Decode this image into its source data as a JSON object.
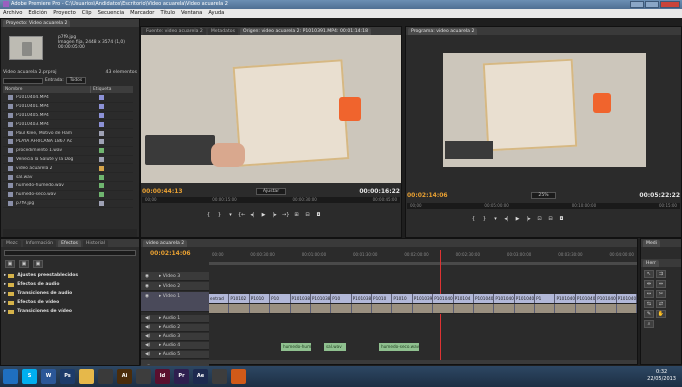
{
  "window": {
    "title": "Adobe Premiere Pro - C:\\Usuarios\\Andidatos\\Escritorio\\Video acuarela\\Video acuarela 2"
  },
  "menu": [
    "Archivo",
    "Edición",
    "Proyecto",
    "Clip",
    "Secuencia",
    "Marcador",
    "Título",
    "Ventana",
    "Ayuda"
  ],
  "project": {
    "tab_label": "Proyecto: Video acuarela 2",
    "preview": {
      "name": "p7f9.jpg",
      "type": "Imagen fija, 2448 x 3574 (1,0)",
      "duration": "00:00:05:00"
    },
    "project_name": "Video acuarela 2.prproj",
    "item_count": "43 elementos",
    "entry_label": "Entrada:",
    "entry_value": "Todos",
    "col_name": "Nombre",
    "col_label": "Etiqueta",
    "files": [
      {
        "name": "P1010404.MP4",
        "chip": "#8c91d6"
      },
      {
        "name": "P1010401.MP4",
        "chip": "#8c91d6"
      },
      {
        "name": "P1010405.MP4",
        "chip": "#8c91d6"
      },
      {
        "name": "P1010403.MP4",
        "chip": "#8c91d6"
      },
      {
        "name": "Paul Klee, Motivo de Ham",
        "chip": "#9fa2b5"
      },
      {
        "name": "PLAYA AFRICANA 1867 Ac",
        "chip": "#9fa2b5"
      },
      {
        "name": "procedimiento 1.wav",
        "chip": "#6fb56f"
      },
      {
        "name": "Venecia la Salute y la Dog",
        "chip": "#9fa2b5"
      },
      {
        "name": "video acuarela 2",
        "chip": "#d6a44a"
      },
      {
        "name": "sal.wav",
        "chip": "#6fb56f"
      },
      {
        "name": "humedo-humedo.wav",
        "chip": "#6fb56f"
      },
      {
        "name": "humedo-seco.wav",
        "chip": "#6fb56f"
      },
      {
        "name": "p7f9.jpg",
        "chip": "#9fa2b5"
      }
    ]
  },
  "source_monitor": {
    "tabs": [
      "Fuente: video acuarela 2",
      "Metadatos",
      "Origen: video acuarela 2: P1010391.MP4: 00:01:14:18"
    ],
    "timecode_in": "00:00:44:13",
    "fit": "Ajustar",
    "timecode_dur": "00:00:16:22",
    "ruler": [
      "00;00",
      "00:00:15:00",
      "00:00:30:00",
      "00:00:45:00"
    ]
  },
  "program_monitor": {
    "tab": "Programa: video acuarela 2",
    "timecode_in": "00:02:14:06",
    "zoom": "25%",
    "timecode_dur": "00:05:22:22",
    "ruler": [
      "00;00",
      "00:05:00:00",
      "00:10:00:00",
      "00:15:00"
    ]
  },
  "timeline": {
    "tab": "video acuarela 2",
    "timecode": "00:02:14:06",
    "ruler": [
      "00:00",
      "00:00:30:00",
      "00:01:00:00",
      "00:01:30:00",
      "00:02:00:00",
      "00:02:30:00",
      "00:03:00:00",
      "00:03:30:00",
      "00:04:00:00"
    ],
    "video_tracks": [
      "Vídeo 3",
      "Vídeo 2",
      "Vídeo 1"
    ],
    "audio_tracks": [
      "Audio 1",
      "Audio 2",
      "Audio 3",
      "Audio 4",
      "Audio 5",
      "Audio 6",
      "Audio 7"
    ],
    "video_clips": [
      "entrad",
      "P10102",
      "P1010",
      "P10",
      "P1010384",
      "P1010385",
      "P10",
      "P1010389",
      "P1010",
      "P1010",
      "P1010391",
      "P1010401",
      "P10104",
      "P1010401",
      "P1010401",
      "P1010401",
      "P1",
      "P1010402",
      "P1010402",
      "P1010403",
      "P1010403"
    ],
    "audio_clips": [
      "humedo-hum",
      "sal.wav",
      "humedo-seco.wav"
    ]
  },
  "tools_tab": "Herr",
  "media_tab": "Medi",
  "left_bottom_tabs": [
    "Mezc",
    "Información",
    "Efectos",
    "Historial"
  ],
  "effects": {
    "folders": [
      "Ajustes preestablecidos",
      "Efectos de audio",
      "Transiciones de audio",
      "Efectos de vídeo",
      "Transiciones de vídeo"
    ]
  },
  "taskbar": {
    "apps": [
      {
        "name": "windows-start-icon",
        "label": "",
        "color": "#1f6fc0"
      },
      {
        "name": "skype-icon",
        "label": "S",
        "color": "#00aff0"
      },
      {
        "name": "word-icon",
        "label": "W",
        "color": "#2b5797"
      },
      {
        "name": "photoshop-icon",
        "label": "Ps",
        "color": "#1c3b6a"
      },
      {
        "name": "explorer-icon",
        "label": "",
        "color": "#e6b84a"
      },
      {
        "name": "spotify-icon",
        "label": "",
        "color": "#3a3a3a"
      },
      {
        "name": "illustrator-icon",
        "label": "Ai",
        "color": "#4a2c0a"
      },
      {
        "name": "chrome-icon",
        "label": "",
        "color": "#3d3d3d"
      },
      {
        "name": "indesign-icon",
        "label": "Id",
        "color": "#5a0f2e"
      },
      {
        "name": "premiere-icon",
        "label": "Pr",
        "color": "#2e1f4f"
      },
      {
        "name": "after-effects-icon",
        "label": "Ae",
        "color": "#1d2a4f"
      },
      {
        "name": "chrome2-icon",
        "label": "",
        "color": "#3d3d3d"
      },
      {
        "name": "media-player-icon",
        "label": "",
        "color": "#d15a19"
      }
    ],
    "time": "0:32",
    "date": "22/05/2013"
  }
}
